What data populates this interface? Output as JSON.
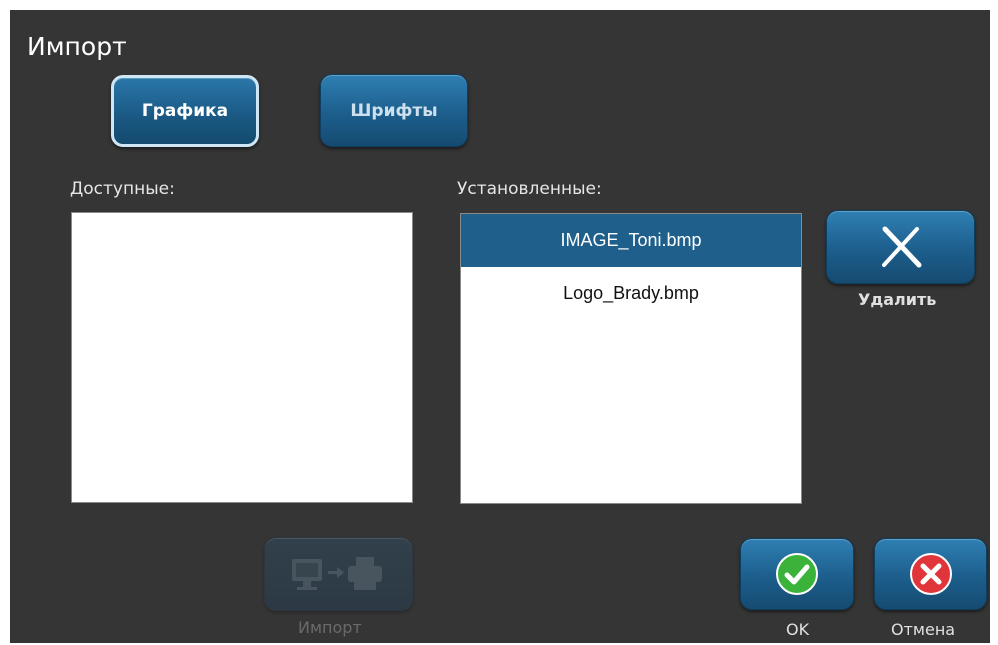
{
  "dialog": {
    "title": "Импорт"
  },
  "tabs": [
    {
      "label": "Графика",
      "selected": true
    },
    {
      "label": "Шрифты",
      "selected": false
    }
  ],
  "available": {
    "label": "Доступные:",
    "items": []
  },
  "installed": {
    "label": "Установленные:",
    "items": [
      {
        "name": "IMAGE_Toni.bmp",
        "selected": true
      },
      {
        "name": "Logo_Brady.bmp",
        "selected": false
      }
    ]
  },
  "actions": {
    "delete_label": "Удалить",
    "import_label": "Импорт",
    "ok_label": "OK",
    "cancel_label": "Отмена"
  },
  "icons": {
    "delete": "x-icon",
    "import": "computer-to-printer-icon",
    "ok": "checkmark-icon",
    "cancel": "cancel-x-icon"
  },
  "colors": {
    "background": "#353535",
    "button": "#1c5e8c",
    "selection": "#1e5f8c",
    "ok_green": "#3bb33b",
    "cancel_red": "#e0353b"
  }
}
